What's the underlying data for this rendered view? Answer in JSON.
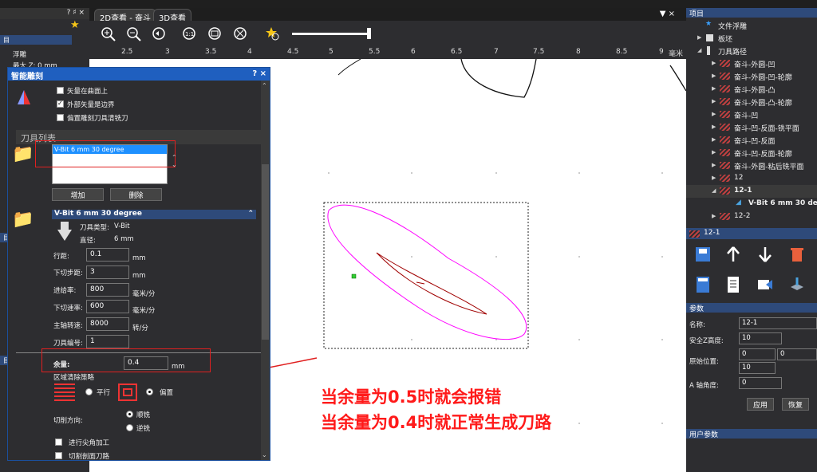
{
  "left_panel": {
    "header_controls": "? ♯ ×",
    "items": [
      "浮雕",
      "最大 Z: 0 mm"
    ],
    "section_label_1": "目",
    "section_label_2": "目",
    "section_label_3": "目"
  },
  "tabs": [
    {
      "label": "2D查看 - 奋斗"
    },
    {
      "label": "3D查看"
    }
  ],
  "ruler": {
    "ticks": [
      "2.5",
      "3",
      "3.5",
      "4",
      "4.5",
      "5",
      "5.5",
      "6",
      "6.5",
      "7",
      "7.5",
      "8",
      "8.5",
      "9"
    ],
    "unit": "毫米"
  },
  "dialog": {
    "title": "智能雕刻",
    "controls": "? ×",
    "checkboxes": [
      {
        "label": "矢量在曲面上",
        "checked": false
      },
      {
        "label": "外部矢量是边界",
        "checked": true
      },
      {
        "label": "偏置雕刻刀具清铣刀",
        "checked": false
      }
    ],
    "tool_list_title": "刀具列表",
    "tool_list_items": [
      "V-Bit 6 mm 30 degree"
    ],
    "add_button": "增加",
    "delete_button": "删除",
    "tool_header": "V-Bit 6 mm 30 degree",
    "tool_type_label": "刀具类型:",
    "tool_type_value": "V-Bit",
    "diameter_label": "直径:",
    "diameter_value": "6 mm",
    "fields": [
      {
        "label": "行距:",
        "value": "0.1",
        "unit": "mm"
      },
      {
        "label": "下切步距:",
        "value": "3",
        "unit": "mm"
      },
      {
        "label": "进给率:",
        "value": "800",
        "unit": "毫米/分"
      },
      {
        "label": "下切速率:",
        "value": "600",
        "unit": "毫米/分"
      },
      {
        "label": "主轴转速:",
        "value": "8000",
        "unit": "转/分"
      },
      {
        "label": "刀具编号:",
        "value": "1",
        "unit": ""
      }
    ],
    "allowance_label": "余量:",
    "allowance_value": "0.4",
    "allowance_unit": "mm",
    "strategy_label": "区域清除策略",
    "strategy_parallel": "平行",
    "strategy_offset": "偏置",
    "cut_direction_label": "切削方向:",
    "cut_climb": "顺铣",
    "cut_conventional": "逆铣",
    "corner_check": "进行尖角加工",
    "last_check": "切割剖面刀路"
  },
  "annotation": {
    "line1": "当余量为0.5时就会报错",
    "line2": "当余量为0.4时就正常生成刀路"
  },
  "right_panel": {
    "project_title": "项目",
    "tree": [
      {
        "label": "文件浮雕",
        "level": 1,
        "icon": "star-icon"
      },
      {
        "label": "板坯",
        "level": 1,
        "icon": "grid-icon"
      },
      {
        "label": "刀具路径",
        "level": 1,
        "icon": "folder-icon"
      },
      {
        "label": "奋斗-外圆-凹",
        "level": 2
      },
      {
        "label": "奋斗-外圆-凹-轮廓",
        "level": 2
      },
      {
        "label": "奋斗-外圆-凸",
        "level": 2
      },
      {
        "label": "奋斗-外圆-凸-轮廓",
        "level": 2
      },
      {
        "label": "奋斗-凹",
        "level": 2
      },
      {
        "label": "奋斗-凹-反面-铣平面",
        "level": 2
      },
      {
        "label": "奋斗-凹-反面",
        "level": 2
      },
      {
        "label": "奋斗-凹-反面-轮廓",
        "level": 2
      },
      {
        "label": "奋斗-外圆-粘后铣平面",
        "level": 2
      },
      {
        "label": "12",
        "level": 2
      },
      {
        "label": "12-1",
        "level": 2
      },
      {
        "label": "V-Bit 6 mm 30 de",
        "level": 3
      },
      {
        "label": "12-2",
        "level": 2
      }
    ],
    "selected_header": "12-1",
    "params_title": "参数",
    "name_label": "名称:",
    "name_value": "12-1",
    "safe_z_label": "安全Z高度:",
    "safe_z_value": "10",
    "home_label": "原始位置:",
    "home_x": "0",
    "home_y": "0",
    "home_z": "10",
    "a_axis_label": "A 轴角度:",
    "a_axis_value": "0",
    "apply_button": "应用",
    "reset_button": "恢复",
    "user_params_title": "用户参数"
  }
}
